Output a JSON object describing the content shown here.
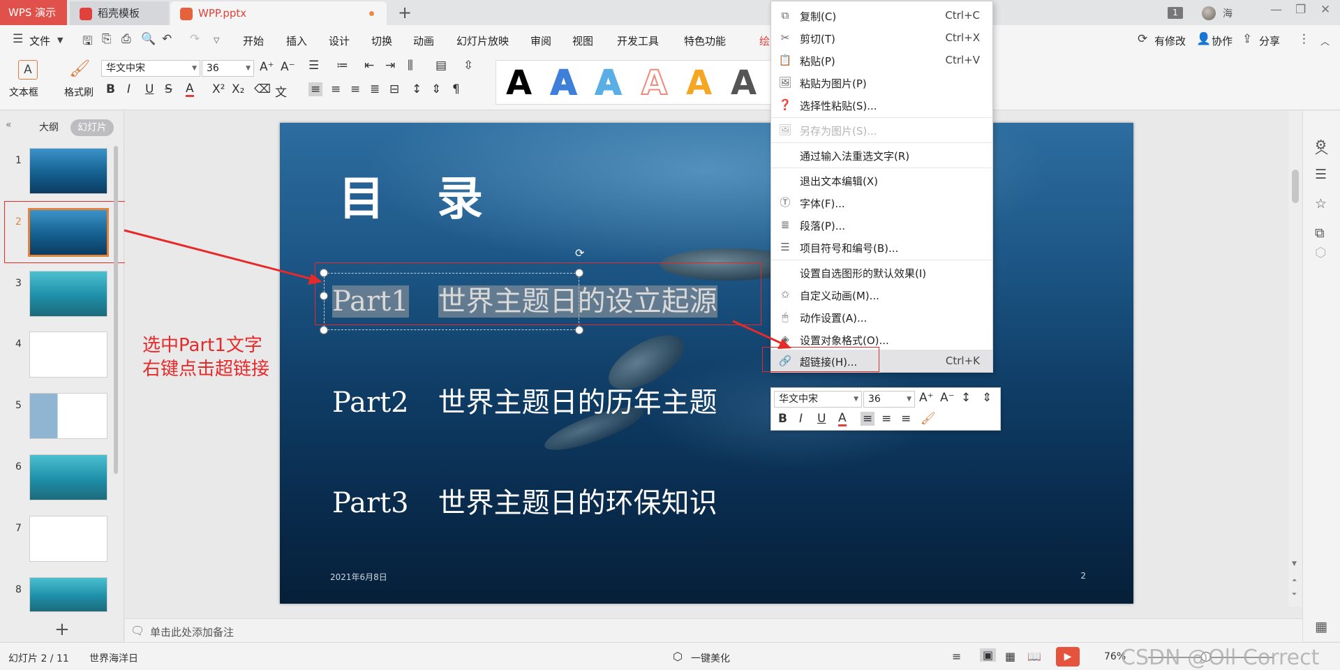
{
  "tabs": {
    "app_name": "WPS 演示",
    "template_tab": "稻壳模板",
    "file_tab": "WPP.pptx",
    "new_tab": "+",
    "window_count": "1",
    "user_name": "海"
  },
  "menu": {
    "file": "文件",
    "items": [
      "开始",
      "插入",
      "设计",
      "切换",
      "动画",
      "幻灯片放映",
      "审阅",
      "视图",
      "开发工具",
      "特色功能",
      "绘"
    ],
    "right": {
      "modified": "有修改",
      "collaborate": "协作",
      "share": "分享"
    }
  },
  "ribbon": {
    "textbox": "文本框",
    "format_painter": "格式刷",
    "font_name": "华文中宋",
    "font_size": "36",
    "wordart_letter": "A",
    "wordart_colors": [
      "#000000",
      "#3d7fd9",
      "#5aaee6",
      "#f08a7a",
      "#f5a623",
      "#555555"
    ]
  },
  "left_panel": {
    "outline_tab": "大纲",
    "slides_tab": "幻灯片",
    "slide_numbers": [
      "1",
      "2",
      "3",
      "4",
      "5",
      "6",
      "7",
      "8"
    ],
    "selected_slide": "2",
    "add": "+"
  },
  "slide": {
    "title": "目 录",
    "parts": [
      {
        "num": "Part1",
        "text": "世界主题日的设立起源"
      },
      {
        "num": "Part2",
        "text": "世界主题日的历年主题"
      },
      {
        "num": "Part3",
        "text": "世界主题日的环保知识"
      }
    ],
    "date": "2021年6月8日",
    "page": "2"
  },
  "context_menu": {
    "items": [
      {
        "icon": "copy-icon",
        "glyph": "⧉",
        "label": "复制(C)",
        "shortcut": "Ctrl+C"
      },
      {
        "icon": "cut-icon",
        "glyph": "✂",
        "label": "剪切(T)",
        "shortcut": "Ctrl+X"
      },
      {
        "icon": "paste-icon",
        "glyph": "📋",
        "label": "粘贴(P)",
        "shortcut": "Ctrl+V"
      },
      {
        "icon": "paste-image-icon",
        "glyph": "🖼",
        "label": "粘贴为图片(P)",
        "shortcut": ""
      },
      {
        "icon": "paste-special-icon",
        "glyph": "❓",
        "label": "选择性粘贴(S)...",
        "shortcut": ""
      },
      {
        "icon": "save-image-icon",
        "glyph": "🖼",
        "label": "另存为图片(S)...",
        "shortcut": "",
        "disabled": true
      },
      {
        "icon": "",
        "glyph": "",
        "label": "通过输入法重选文字(R)",
        "shortcut": ""
      },
      {
        "icon": "",
        "glyph": "",
        "label": "退出文本编辑(X)",
        "shortcut": ""
      },
      {
        "icon": "font-icon",
        "glyph": "Ⓣ",
        "label": "字体(F)...",
        "shortcut": ""
      },
      {
        "icon": "paragraph-icon",
        "glyph": "≣",
        "label": "段落(P)...",
        "shortcut": ""
      },
      {
        "icon": "bullets-icon",
        "glyph": "☰",
        "label": "项目符号和编号(B)...",
        "shortcut": ""
      },
      {
        "icon": "",
        "glyph": "",
        "label": "设置自选图形的默认效果(I)",
        "shortcut": ""
      },
      {
        "icon": "animation-icon",
        "glyph": "✩",
        "label": "自定义动画(M)...",
        "shortcut": ""
      },
      {
        "icon": "action-icon",
        "glyph": "🖱",
        "label": "动作设置(A)...",
        "shortcut": ""
      },
      {
        "icon": "format-object-icon",
        "glyph": "◈",
        "label": "设置对象格式(O)...",
        "shortcut": ""
      },
      {
        "icon": "hyperlink-icon",
        "glyph": "🔗",
        "label": "超链接(H)...",
        "shortcut": "Ctrl+K",
        "hover": true
      }
    ]
  },
  "mini_toolbar": {
    "font_name": "华文中宋",
    "font_size": "36",
    "bold": "B",
    "italic": "I",
    "underline": "U",
    "font_color": "A"
  },
  "annotation": {
    "line1": "选中Part1文字",
    "line2": "右键点击超链接",
    "color": "#e62a2a"
  },
  "notes": {
    "placeholder": "单击此处添加备注"
  },
  "status": {
    "slide_count": "幻灯片 2 / 11",
    "theme_name": "世界海洋日",
    "beautify": "一键美化",
    "zoom": "76%",
    "watermark": "CSDN @Oll Correct"
  }
}
